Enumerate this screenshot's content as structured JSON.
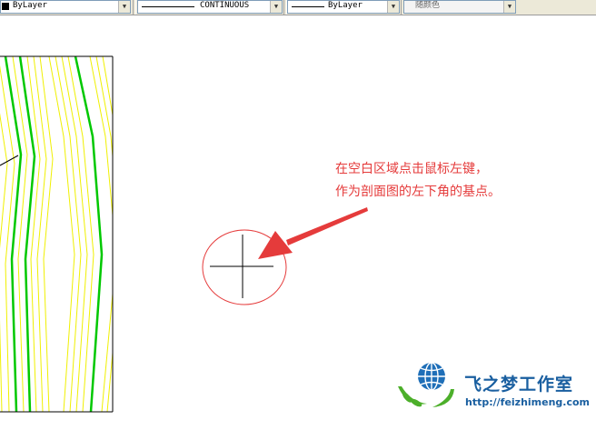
{
  "toolbar": {
    "color_control": {
      "value": "ByLayer"
    },
    "linetype_control": {
      "value": "CONTINUOUS"
    },
    "lineweight_control": {
      "value": "ByLayer"
    },
    "plotstyle_control": {
      "value": "随颜色"
    }
  },
  "annotation": {
    "line1": "在空白区域点击鼠标左键，",
    "line2": "作为剖面图的左下角的基点。",
    "color": "#e53b3b"
  },
  "watermark": {
    "name": "飞之梦工作室",
    "url": "http://feizhimeng.com"
  },
  "colors": {
    "contour_minor": "#f0f000",
    "contour_major": "#00c800",
    "annotation": "#e53b3b",
    "brand": "#1a5fa0"
  }
}
